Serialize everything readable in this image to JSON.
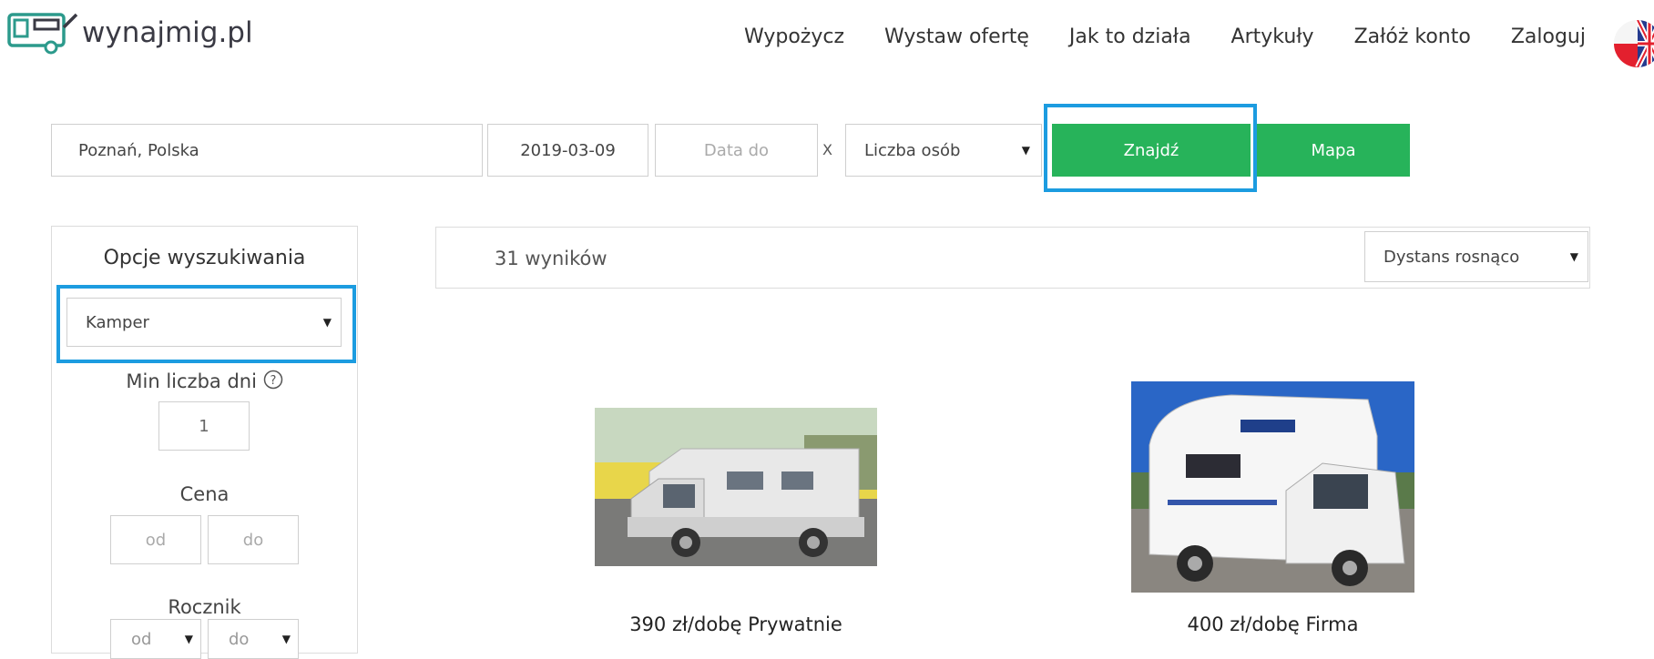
{
  "header": {
    "logo_text": "wynajmig.pl",
    "nav": [
      "Wypożycz",
      "Wystaw ofertę",
      "Jak to działa",
      "Artykuły",
      "Załóż konto",
      "Zaloguj"
    ]
  },
  "search": {
    "location_value": "Poznań, Polska",
    "date_from_value": "2019-03-09",
    "date_to_placeholder": "Data do",
    "clear_label": "X",
    "persons_selected": "Liczba osób",
    "find_label": "Znajdź",
    "map_label": "Mapa"
  },
  "sidebar": {
    "title": "Opcje wyszukiwania",
    "type_selected": "Kamper",
    "min_days_label": "Min liczba dni",
    "min_days_value": "1",
    "price_label": "Cena",
    "price_from_placeholder": "od",
    "price_to_placeholder": "do",
    "year_label": "Rocznik",
    "year_from_selected": "od",
    "year_to_selected": "do"
  },
  "results": {
    "count_text": "31 wyników",
    "sort_selected": "Dystans rosnąco"
  },
  "cards": [
    {
      "caption": "390 zł/dobę Prywatnie"
    },
    {
      "caption": "400 zł/dobę Firma"
    }
  ],
  "colors": {
    "accent_green": "#27b35a",
    "highlight_blue": "#1c9ce0",
    "logo_teal": "#2c9a8c"
  }
}
